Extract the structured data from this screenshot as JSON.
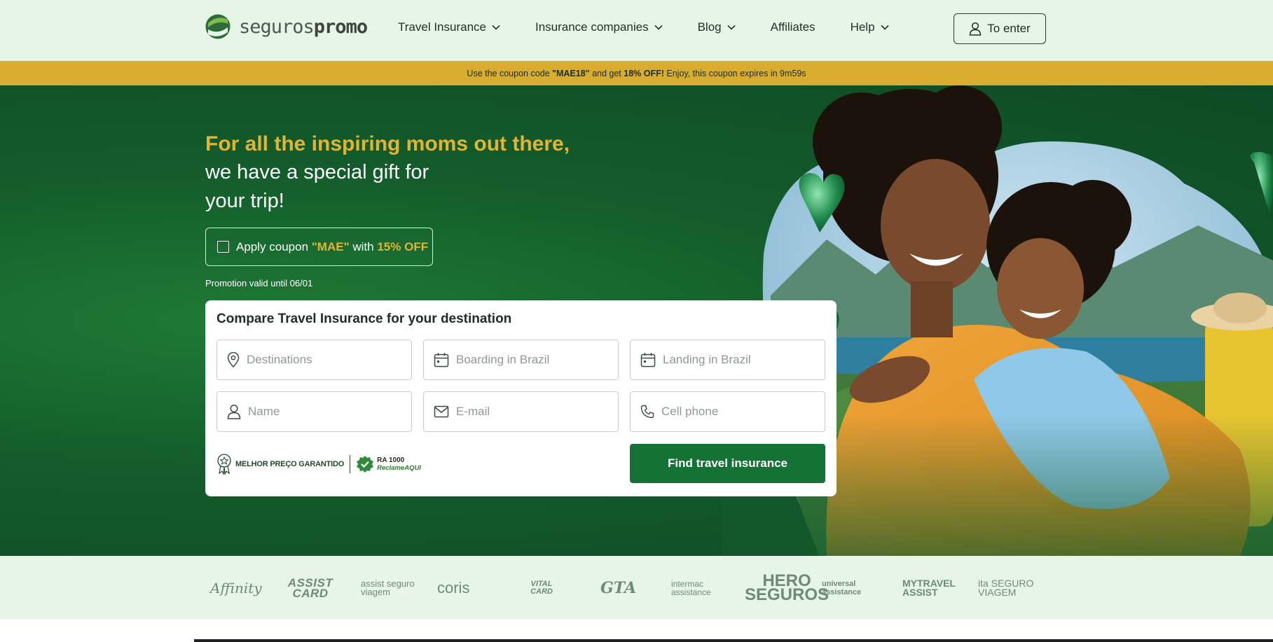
{
  "header": {
    "logo": {
      "text_light": "seguros",
      "text_bold": "promo"
    },
    "nav": [
      {
        "label": "Travel Insurance",
        "dropdown": true
      },
      {
        "label": "Insurance companies",
        "dropdown": true
      },
      {
        "label": "Blog",
        "dropdown": true
      },
      {
        "label": "Affiliates",
        "dropdown": false
      },
      {
        "label": "Help",
        "dropdown": true
      }
    ],
    "enter_label": "To enter"
  },
  "coupon_bar": {
    "prefix": "Use the coupon code ",
    "code": "\"MAE18\"",
    "middle": " and get ",
    "discount": "18% OFF!",
    "suffix": " Enjoy, this coupon expires in 9m59s"
  },
  "hero": {
    "headline_gold": "For all the inspiring moms out there,",
    "headline_line2": "we have a special gift for",
    "headline_line3": "your trip!",
    "apply": {
      "prefix": "Apply coupon ",
      "code": "\"MAE\"",
      "middle": " with ",
      "discount": "15% OFF",
      "checked": false
    },
    "promo_valid": "Promotion valid until 06/01"
  },
  "form": {
    "title": "Compare Travel Insurance for your destination",
    "fields": {
      "destinations": {
        "placeholder": "Destinations",
        "value": ""
      },
      "boarding": {
        "placeholder": "Boarding in Brazil",
        "value": ""
      },
      "landing": {
        "placeholder": "Landing in Brazil",
        "value": ""
      },
      "name": {
        "placeholder": "Name",
        "value": ""
      },
      "email": {
        "placeholder": "E-mail",
        "value": ""
      },
      "phone": {
        "placeholder": "Cell phone",
        "value": ""
      }
    },
    "badge_best_price": "MELHOR PREÇO GARANTIDO",
    "badge_ra_line1": "RA 1000",
    "badge_ra_line2": "ReclameAQUI",
    "submit_label": "Find travel insurance"
  },
  "partners": [
    "Affinity",
    "ASSIST CARD",
    "assist seguro viagem",
    "coris",
    "VITAL CARD",
    "GTA",
    "intermac assistance",
    "HERO SEGUROS",
    "universal assistance",
    "MYTRAVEL ASSIST",
    "ita SEGURO VIAGEM"
  ],
  "colors": {
    "header_bg": "#e6f5e6",
    "coupon_bg": "#d8ad2f",
    "hero_green": "#135c2b",
    "accent_gold": "#e2b42f",
    "button_green": "#157236"
  }
}
